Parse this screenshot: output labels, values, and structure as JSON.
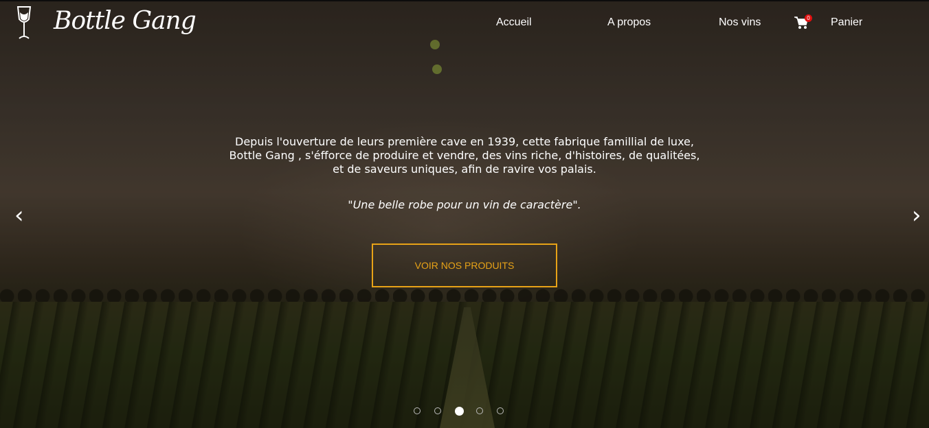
{
  "brand": {
    "name": "Bottle Gang",
    "logo_icon": "wine-glass-icon"
  },
  "nav": {
    "home": "Accueil",
    "about": "A propos",
    "wines": "Nos vins",
    "cart_icon": "shopping-cart-icon",
    "cart_count": "0",
    "cart": "Panier"
  },
  "hero": {
    "intro_lines": [
      "Depuis l'ouverture de leurs première cave en 1939, cette fabrique famillial de luxe,",
      "Bottle Gang , s'éfforce de produire et vendre, des vins riche, d'histoires, de qualitées,",
      "et de saveurs uniques, afin de ravire vos palais."
    ],
    "quote": "\"Une belle robe pour un vin de caractère\".",
    "cta_label": "VOIR NOS PRODUITS",
    "prev_arrow": "‹",
    "next_arrow": "›",
    "slide_count": 5,
    "active_slide": 3
  },
  "colors": {
    "accent": "#e8a317",
    "badge": "#e01010",
    "text": "#ffffff"
  }
}
